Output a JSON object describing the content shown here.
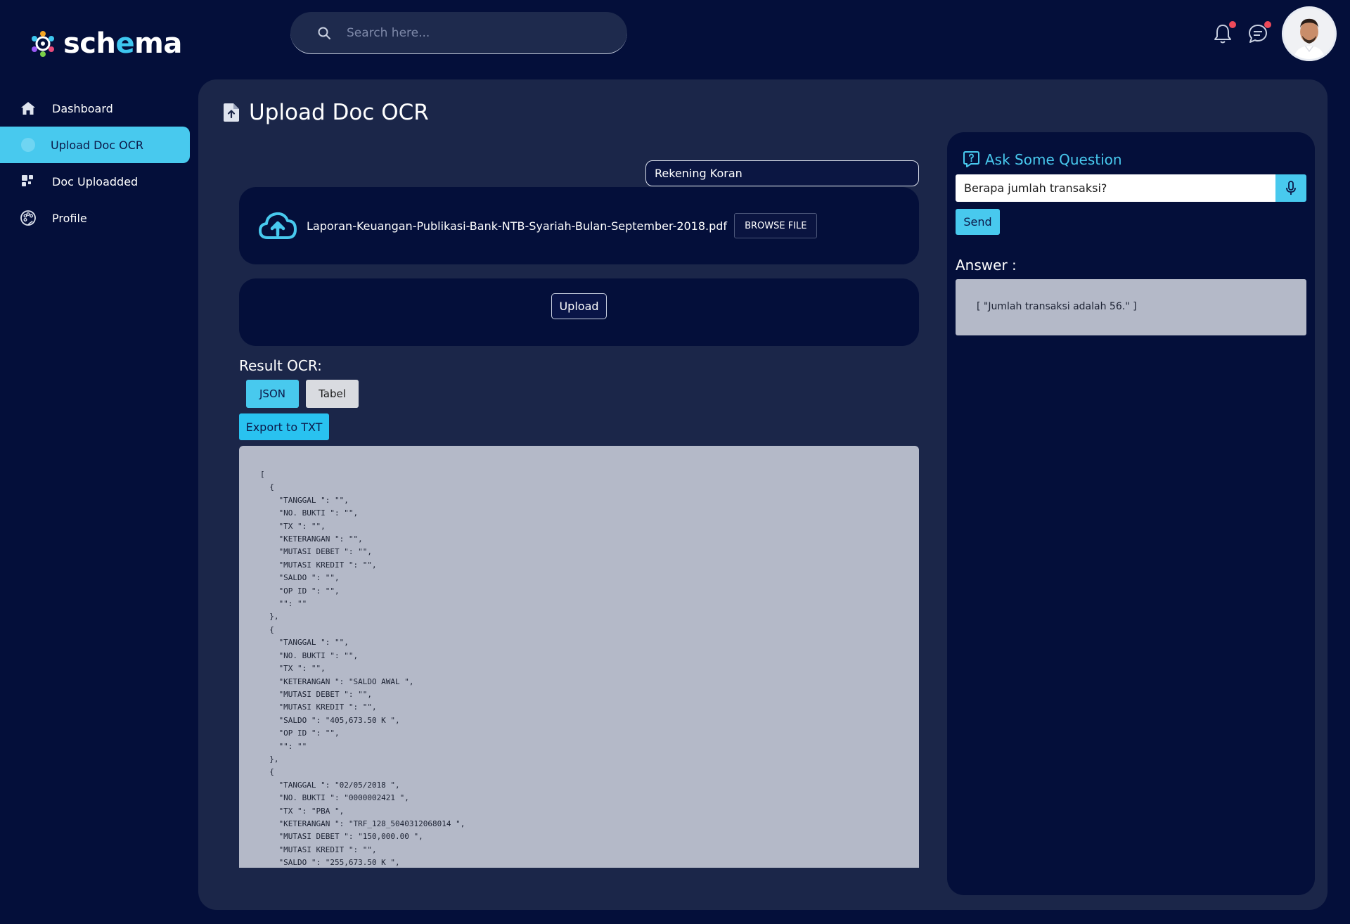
{
  "header": {
    "logo_text_1": "sch",
    "logo_text_2": "e",
    "logo_text_3": "ma",
    "search_placeholder": "Search here..."
  },
  "sidebar": {
    "items": [
      {
        "label": "Dashboard",
        "icon": "home-icon"
      },
      {
        "label": "Upload Doc OCR",
        "icon": "upload-icon",
        "active": true
      },
      {
        "label": "Doc Uploadded",
        "icon": "grid-icon"
      },
      {
        "label": "Profile",
        "icon": "palette-icon"
      }
    ]
  },
  "main": {
    "title": "Upload Doc OCR",
    "doc_type": "Rekening Koran",
    "file_name": "Laporan-Keuangan-Publikasi-Bank-NTB-Syariah-Bulan-September-2018.pdf",
    "browse_label": "BROWSE FILE",
    "upload_label": "Upload",
    "result_label": "Result OCR:",
    "tabs": [
      "JSON",
      "Tabel"
    ],
    "export_label": "Export to TXT",
    "json_output": "[\n  {\n    \"TANGGAL \": \"\",\n    \"NO. BUKTI \": \"\",\n    \"TX \": \"\",\n    \"KETERANGAN \": \"\",\n    \"MUTASI DEBET \": \"\",\n    \"MUTASI KREDIT \": \"\",\n    \"SALDO \": \"\",\n    \"OP ID \": \"\",\n    \"\": \"\"\n  },\n  {\n    \"TANGGAL \": \"\",\n    \"NO. BUKTI \": \"\",\n    \"TX \": \"\",\n    \"KETERANGAN \": \"SALDO AWAL \",\n    \"MUTASI DEBET \": \"\",\n    \"MUTASI KREDIT \": \"\",\n    \"SALDO \": \"405,673.50 K \",\n    \"OP ID \": \"\",\n    \"\": \"\"\n  },\n  {\n    \"TANGGAL \": \"02/05/2018 \",\n    \"NO. BUKTI \": \"0000002421 \",\n    \"TX \": \"PBA \",\n    \"KETERANGAN \": \"TRF_128_5040312068014 \",\n    \"MUTASI DEBET \": \"150,000.00 \",\n    \"MUTASI KREDIT \": \"\",\n    \"SALDO \": \"255,673.50 K \","
  },
  "qa": {
    "title": "Ask Some Question",
    "question": "Berapa jumlah transaksi?",
    "send_label": "Send",
    "answer_label": "Answer :",
    "answer": "[ \"Jumlah transaksi adalah 56.\" ]"
  },
  "colors": {
    "background": "#040f3a",
    "panel": "#1b2649",
    "accent": "#48c9ee",
    "notification_dot": "#ef4a5a"
  }
}
